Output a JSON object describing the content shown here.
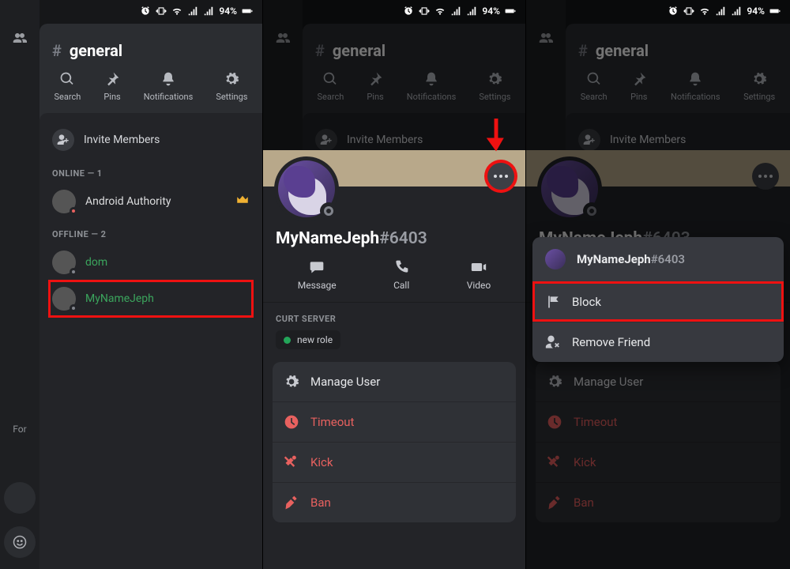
{
  "status": {
    "battery_pct": "94%"
  },
  "channel": {
    "name": "general"
  },
  "toolbar": {
    "search": "Search",
    "pins": "Pins",
    "notifications": "Notifications",
    "settings": "Settings"
  },
  "invite_label": "Invite Members",
  "sections": {
    "online": "ONLINE — 1",
    "offline": "OFFLINE — 2"
  },
  "members": {
    "online": [
      {
        "name": "Android Authority",
        "owner": true
      }
    ],
    "offline": [
      {
        "name": "dom"
      },
      {
        "name": "MyNameJeph"
      }
    ]
  },
  "rail": {
    "for": "For"
  },
  "profile": {
    "username": "MyNameJeph",
    "discriminator": "#6403",
    "actions": {
      "message": "Message",
      "call": "Call",
      "video": "Video"
    },
    "server_label": "CURT SERVER",
    "role_chip": "new role",
    "mgmt": {
      "manage": "Manage User",
      "timeout": "Timeout",
      "kick": "Kick",
      "ban": "Ban"
    }
  },
  "popup": {
    "username": "MyNameJeph",
    "discriminator": "#6403",
    "block": "Block",
    "remove_friend": "Remove Friend"
  }
}
